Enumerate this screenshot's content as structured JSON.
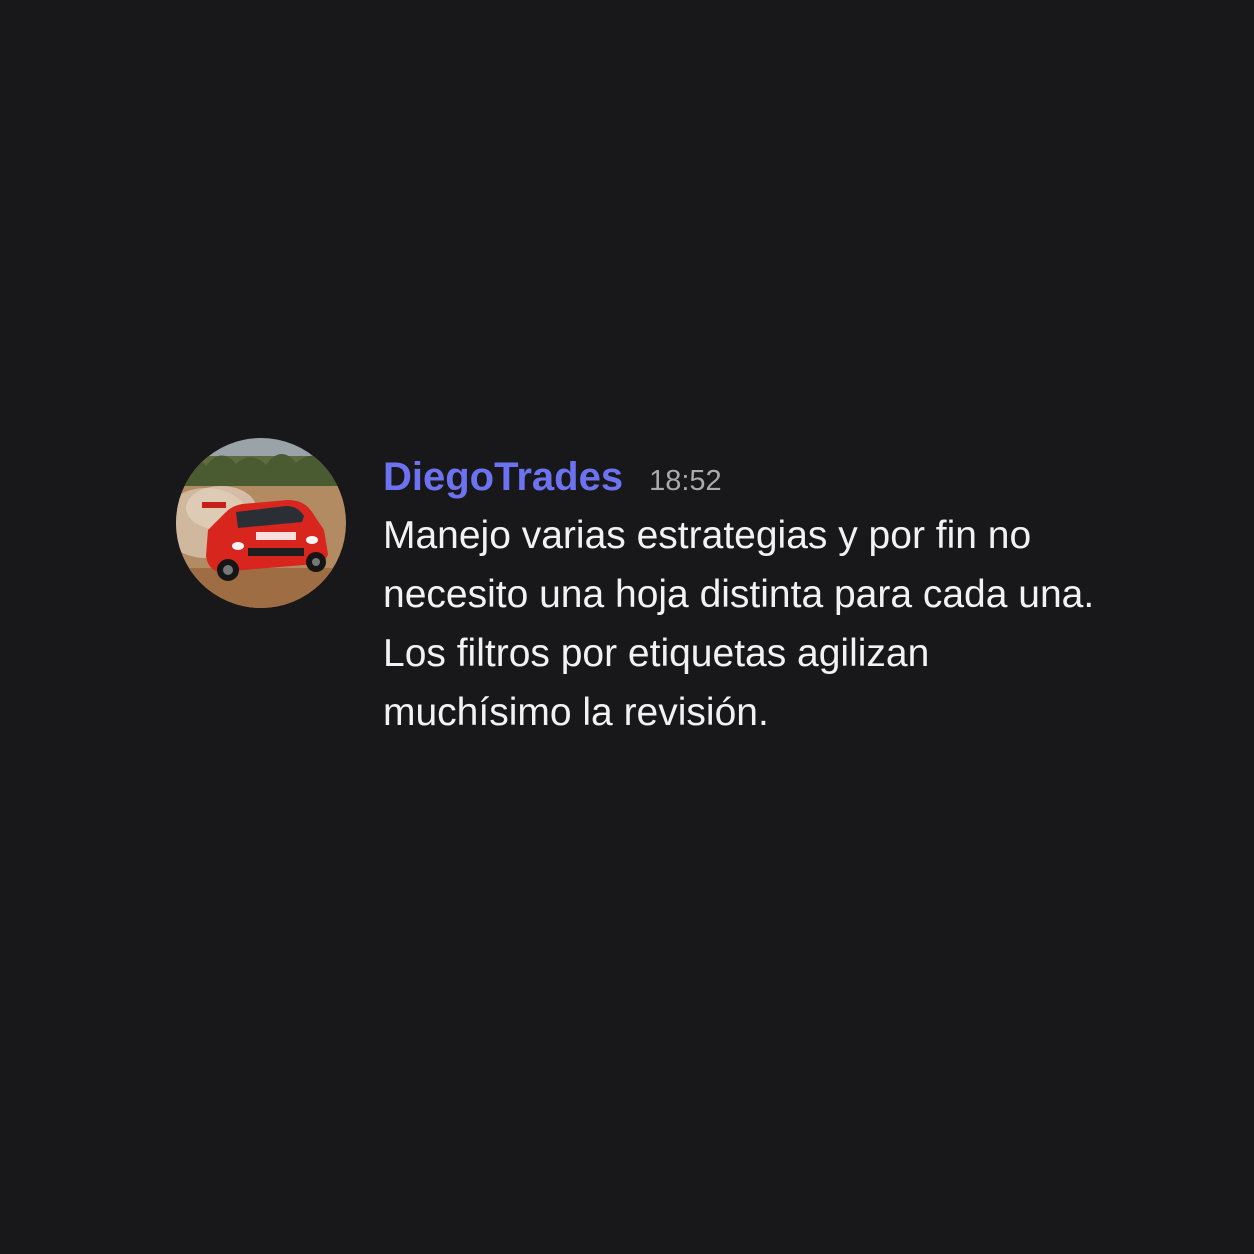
{
  "message": {
    "username": "DiegoTrades",
    "timestamp": "18:52",
    "avatar_icon": "rally-car-avatar",
    "lines": [
      "Manejo varias estrategias y por fin no",
      "necesito una hoja distinta para cada una.",
      "Los filtros por etiquetas agilizan",
      "muchísimo la revisión."
    ]
  },
  "colors": {
    "background": "#18181a",
    "username": "#6d73f0",
    "timestamp": "#a9a9ae",
    "text": "#f2f2f4"
  }
}
